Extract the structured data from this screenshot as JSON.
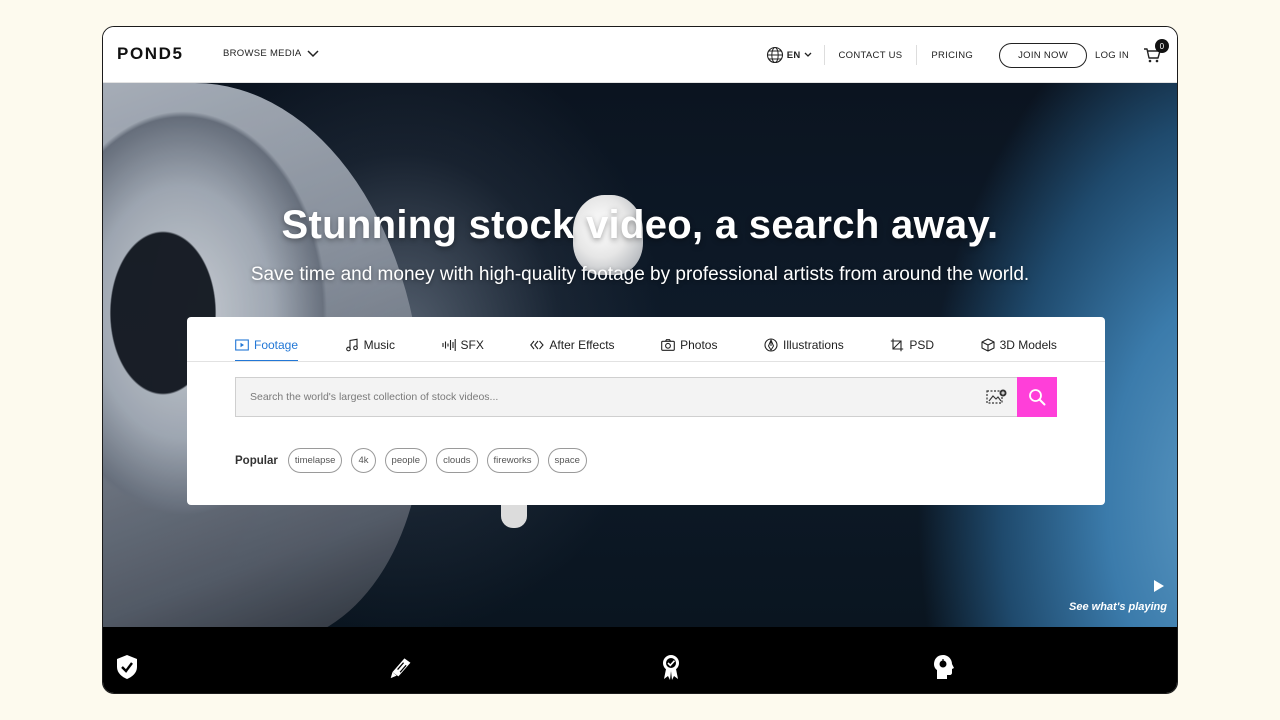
{
  "nav": {
    "logo": "POND5",
    "browse_label": "BROWSE MEDIA",
    "language": "EN",
    "contact": "CONTACT US",
    "pricing": "PRICING",
    "join": "JOIN NOW",
    "login": "LOG IN",
    "cart_count": "0"
  },
  "hero": {
    "title": "Stunning stock video, a search away.",
    "subtitle": "Save time and money with high-quality footage by professional artists from around the world.",
    "see_playing": "See what's playing"
  },
  "search": {
    "tabs": [
      {
        "label": "Footage",
        "icon": "footage-icon",
        "active": true
      },
      {
        "label": "Music",
        "icon": "music-icon"
      },
      {
        "label": "SFX",
        "icon": "sfx-icon"
      },
      {
        "label": "After Effects",
        "icon": "after-effects-icon"
      },
      {
        "label": "Photos",
        "icon": "camera-icon"
      },
      {
        "label": "Illustrations",
        "icon": "illustrations-icon"
      },
      {
        "label": "PSD",
        "icon": "psd-icon"
      },
      {
        "label": "3D Models",
        "icon": "cube-icon"
      }
    ],
    "placeholder": "Search the world's largest collection of stock videos...",
    "value": "",
    "popular_label": "Popular",
    "popular_tags": [
      "timelapse",
      "4k",
      "people",
      "clouds",
      "fireworks",
      "space"
    ]
  },
  "colors": {
    "accent": "#2277d6",
    "search_button": "#ff3fd9",
    "page_bg": "#fdfaee"
  }
}
